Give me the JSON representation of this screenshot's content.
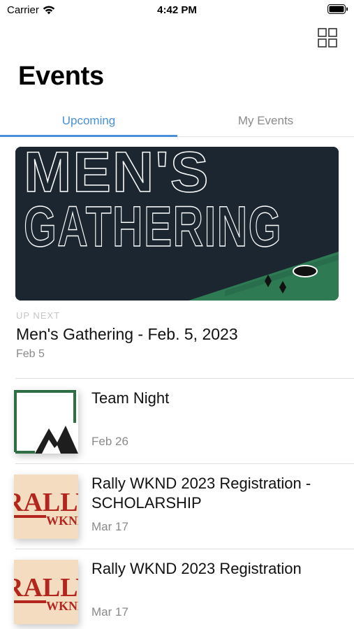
{
  "status_bar": {
    "carrier": "Carrier",
    "time": "4:42 PM",
    "wifi_icon": "wifi-icon",
    "battery_icon": "battery-icon"
  },
  "header": {
    "title": "Events",
    "grid_icon": "grid-icon"
  },
  "tabs": [
    {
      "label": "Upcoming",
      "active": true
    },
    {
      "label": "My Events",
      "active": false
    }
  ],
  "featured": {
    "banner_text_line1": "MEN'S",
    "banner_text_line2": "GATHERING",
    "label": "UP NEXT",
    "title": "Men's Gathering - Feb. 5, 2023",
    "date": "Feb 5"
  },
  "events": [
    {
      "title": "Team Night",
      "date": "Feb 26",
      "thumb": "mountain-logo"
    },
    {
      "title": "Rally WKND 2023 Registration - SCHOLARSHIP",
      "date": "Mar 17",
      "thumb": "rally-wknd-logo",
      "thumb_text1": "RALLY",
      "thumb_text2": "WKND"
    },
    {
      "title": "Rally WKND 2023 Registration",
      "date": "Mar 17",
      "thumb": "rally-wknd-logo",
      "thumb_text1": "RALLY",
      "thumb_text2": "WKND"
    }
  ],
  "colors": {
    "accent": "#4a8fd9",
    "banner_bg": "#1b2630",
    "cornhole_green": "#2e7a52",
    "rally_bg": "#f3dcc0",
    "rally_red": "#b3261e"
  }
}
